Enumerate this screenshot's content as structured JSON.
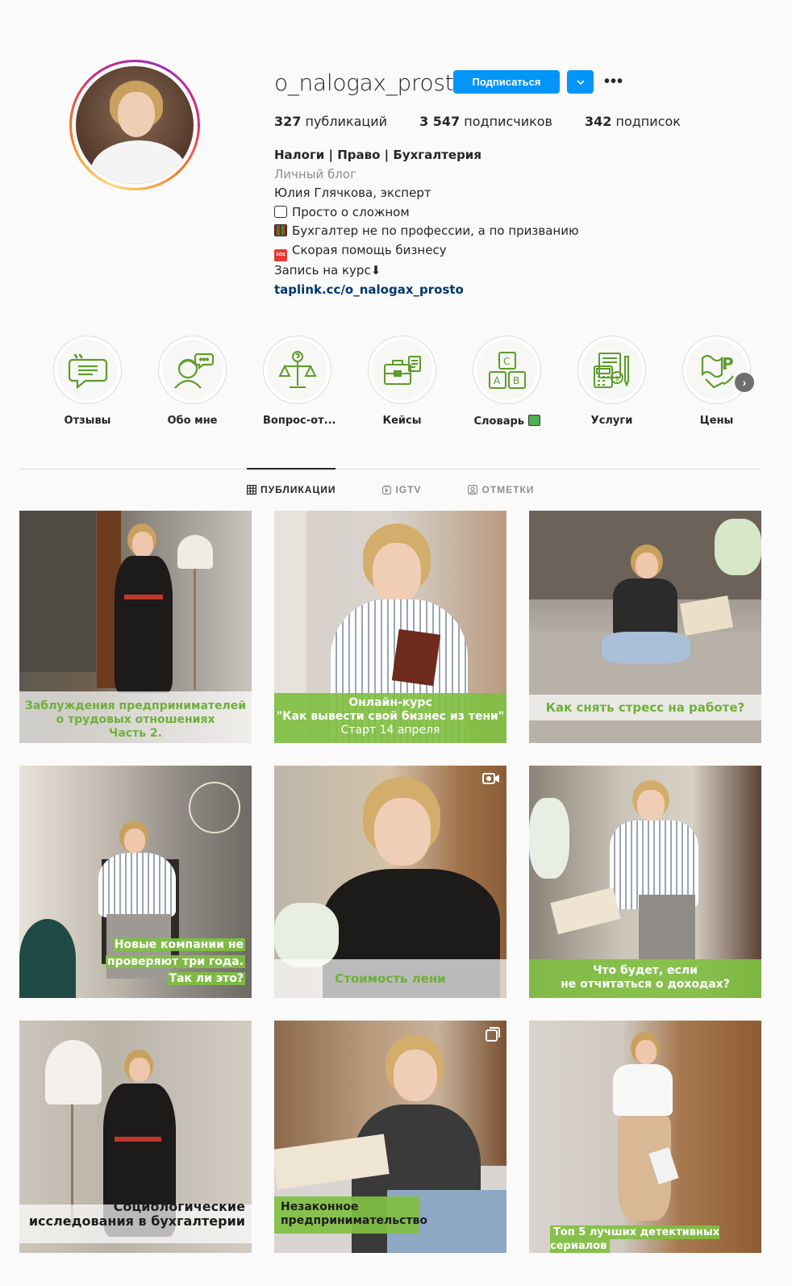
{
  "profile": {
    "username": "o_nalogax_prosto",
    "follow_label": "Подписаться",
    "more_label": "•••",
    "stats": {
      "posts_count": "327",
      "posts_label": "публикаций",
      "followers_count": "3 547",
      "followers_label": "подписчиков",
      "following_count": "342",
      "following_label": "подписок"
    },
    "bio": {
      "name": "Налоги | Право | Бухгалтерия",
      "category": "Личный блог",
      "line1": "Юлия Глячкова, эксперт",
      "line2": "Просто о сложном",
      "line3": "Бухгалтер не по профессии, а по призванию",
      "line4": "Скорая помощь бизнесу",
      "line5": "Запись на курс⬇",
      "link": "taplink.cc/o_nalogax_prosto"
    }
  },
  "highlights": [
    {
      "label": "Отзывы",
      "icon": "quote-chat-icon"
    },
    {
      "label": "Обо мне",
      "icon": "person-chat-icon"
    },
    {
      "label": "Вопрос-от...",
      "icon": "scales-icon"
    },
    {
      "label": "Кейсы",
      "icon": "briefcase-icon"
    },
    {
      "label": "Словарь",
      "icon": "abc-blocks-icon"
    },
    {
      "label": "Услуги",
      "icon": "calculator-icon"
    },
    {
      "label": "Цены",
      "icon": "price-tag-icon"
    }
  ],
  "tabs": [
    {
      "label": "ПУБЛИКАЦИИ",
      "active": true
    },
    {
      "label": "IGTV",
      "active": false
    },
    {
      "label": "ОТМЕТКИ",
      "active": false
    }
  ],
  "posts": [
    {
      "caption_lines": [
        "Заблуждения предпринимателей",
        "о трудовых отношениях",
        "Часть 2."
      ]
    },
    {
      "caption_lines": [
        "Онлайн-курс",
        "\"Как вывести свой бизнес из тени\"",
        "Старт 14 апреля"
      ]
    },
    {
      "caption_lines": [
        "Как снять стресс на работе?"
      ]
    },
    {
      "caption_lines": [
        "Новые компании не",
        "проверяют три года.",
        "Так ли это?"
      ]
    },
    {
      "caption_lines": [
        "Стоимость лени"
      ]
    },
    {
      "caption_lines": [
        "Что будет, если",
        "не отчитаться о доходах?"
      ]
    },
    {
      "caption_lines": [
        "Социологические",
        "исследования в бухгалтерии"
      ]
    },
    {
      "caption_lines": [
        "Незаконное",
        "предпринимательство"
      ]
    },
    {
      "caption_lines": [
        "Топ 5 лучших детективных сериалов"
      ]
    }
  ],
  "colors": {
    "accent": "#0095f6",
    "brand_green": "#80bf42",
    "link": "#00376b"
  }
}
